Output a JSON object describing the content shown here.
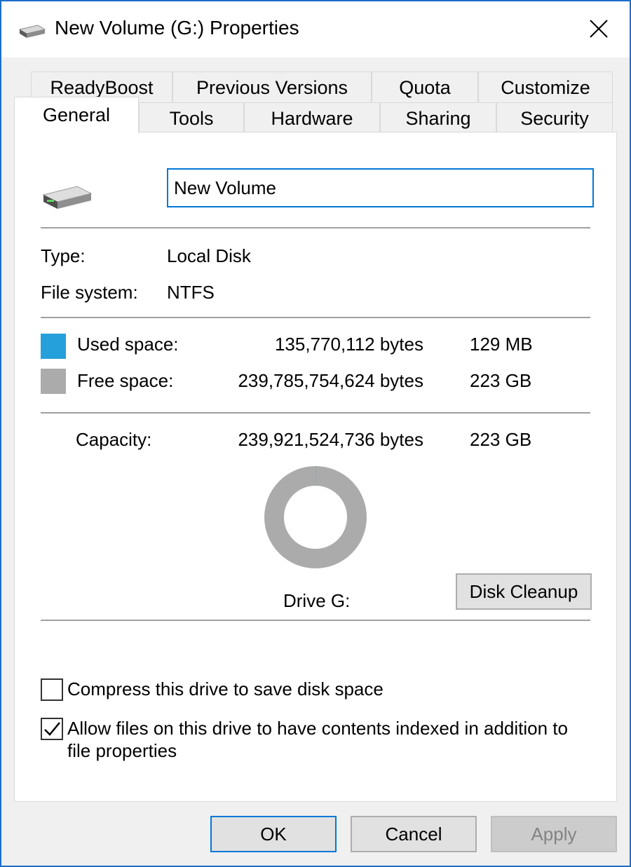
{
  "window": {
    "title": "New Volume (G:) Properties",
    "icons": {
      "title": "drive-icon",
      "close": "close-icon"
    }
  },
  "tabs": {
    "row1": [
      "ReadyBoost",
      "Previous Versions",
      "Quota",
      "Customize"
    ],
    "row2": [
      "General",
      "Tools",
      "Hardware",
      "Sharing",
      "Security"
    ],
    "active": "General"
  },
  "general": {
    "volume_name": "New Volume",
    "type_label": "Type:",
    "type_value": "Local Disk",
    "fs_label": "File system:",
    "fs_value": "NTFS",
    "used_label": "Used space:",
    "used_bytes": "135,770,112 bytes",
    "used_size": "129 MB",
    "free_label": "Free space:",
    "free_bytes": "239,785,754,624 bytes",
    "free_size": "223 GB",
    "capacity_label": "Capacity:",
    "capacity_bytes": "239,921,524,736 bytes",
    "capacity_size": "223 GB",
    "drive_label": "Drive G:",
    "disk_cleanup": "Disk Cleanup",
    "compress_label": "Compress this drive to save disk space",
    "compress_checked": false,
    "index_label_line1": "Allow files on this drive to have contents indexed in addition to",
    "index_label_line2": "file properties",
    "index_checked": true
  },
  "usage": {
    "used_bytes": 135770112,
    "free_bytes": 239785754624
  },
  "colors": {
    "used": "#26a0da",
    "free": "#ababab",
    "accent": "#0078d7"
  },
  "buttons": {
    "ok": "OK",
    "cancel": "Cancel",
    "apply": "Apply"
  }
}
